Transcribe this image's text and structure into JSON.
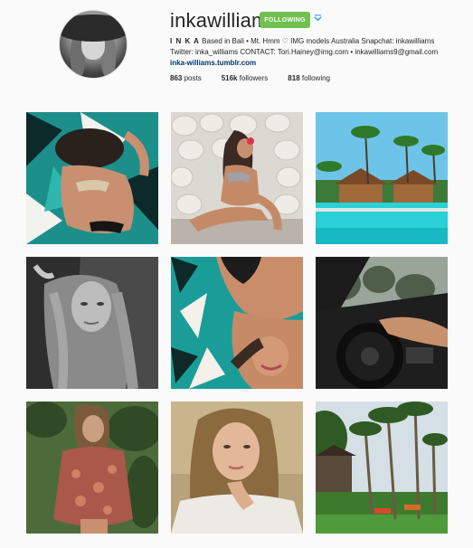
{
  "profile": {
    "username": "inkawilliams",
    "follow_label": "FOLLOWING",
    "name": "I N K A",
    "bio_line1": " Based in Bali • Mt. Hmm ♡ IMG models Australia Snapchat: inkawilliams",
    "bio_line2": "Twitter: inka_williams CONTACT: Tori.Hainey@img.com • inkawilliams9@gmail.com",
    "website": "inka-williams.tumblr.com"
  },
  "stats": {
    "posts_count": "863",
    "posts_label": " posts",
    "followers_count": "516k",
    "followers_label": " followers",
    "following_count": "818",
    "following_label": " following"
  },
  "colors": {
    "following_button": "#70c050",
    "link": "#003569",
    "background": "#fafafa"
  },
  "icons": {
    "dropdown": "chevron-down-icon"
  },
  "posts": [
    {
      "id": "post-1",
      "subject": "bikini-on-patterned-towel"
    },
    {
      "id": "post-2",
      "subject": "bikini-on-stone-wall"
    },
    {
      "id": "post-3",
      "subject": "tropical-pool-villas"
    },
    {
      "id": "post-4",
      "subject": "black-and-white-portrait"
    },
    {
      "id": "post-5",
      "subject": "lying-on-patterned-towel"
    },
    {
      "id": "post-6",
      "subject": "car-steering-wheel"
    },
    {
      "id": "post-7",
      "subject": "jungle-floral-outfit"
    },
    {
      "id": "post-8",
      "subject": "white-shirt-portrait"
    },
    {
      "id": "post-9",
      "subject": "palm-tree-garden"
    }
  ]
}
